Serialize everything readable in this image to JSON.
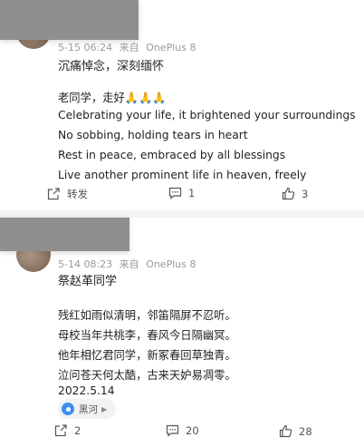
{
  "posts": [
    {
      "meta_date": "5-15 06:24",
      "meta_from": "来自",
      "meta_device": "OnePlus 8",
      "title": "沉痛悼念，深刻缅怀",
      "lines": [
        "老同学，走好🙏🙏🙏",
        "Celebrating your life, it brightened your surroundings",
        "No sobbing, holding tears in heart",
        "Rest in peace, embraced by all blessings",
        "Live another prominent life in heaven, freely"
      ],
      "actions": {
        "share_label": "转发",
        "comment_count": "1",
        "like_count": "3"
      }
    },
    {
      "meta_date": "5-14 08:23",
      "meta_from": "来自",
      "meta_device": "OnePlus 8",
      "title": "祭赵革同学",
      "lines": [
        "残红如雨似清明，邻笛隔屏不忍听。",
        "母校当年共桃李，春风今日隔幽冥。",
        "他年相忆君同学，新冢春回草独青。",
        "泣问苍天何太酷，古来天妒易凋零。",
        "2022.5.14"
      ],
      "tag": "黑河",
      "actions": {
        "share_count": "2",
        "comment_count": "20",
        "like_count": "28"
      }
    }
  ],
  "colors": {
    "accent_pin": "#3d8ef0",
    "meta_gray": "#9a9a9a",
    "divider": "#f3f3f3"
  }
}
